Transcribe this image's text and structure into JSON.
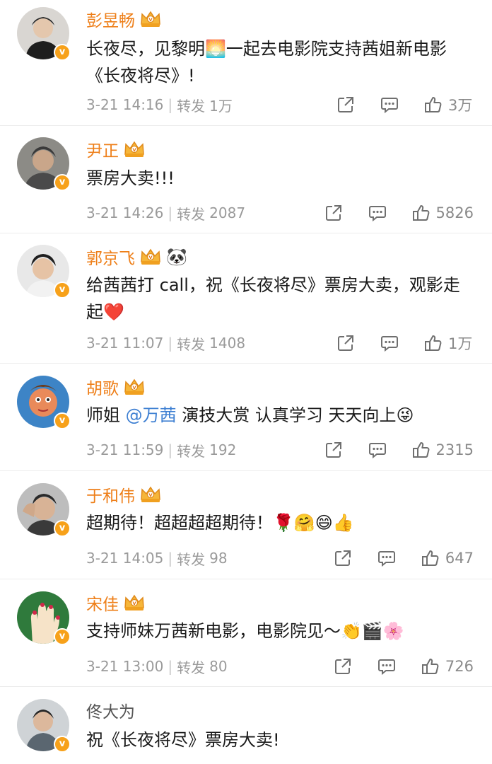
{
  "comments": [
    {
      "name": "彭昱畅",
      "text": "长夜尽，见黎明🌅一起去电影院支持茜姐新电影《长夜将尽》!",
      "time": "3-21 14:16",
      "repost_label": "转发",
      "repost_count": "1万",
      "likes": "3万"
    },
    {
      "name": "尹正",
      "text": "票房大卖!!!",
      "time": "3-21 14:26",
      "repost_label": "转发",
      "repost_count": "2087",
      "likes": "5826"
    },
    {
      "name": "郭京飞",
      "name_emoji": "🐼",
      "text": "给茜茜打 call，祝《长夜将尽》票房大卖，观影走起❤️",
      "time": "3-21 11:07",
      "repost_label": "转发",
      "repost_count": "1408",
      "likes": "1万"
    },
    {
      "name": "胡歌",
      "text_before": "师姐 ",
      "mention": "@万茜",
      "text_after": " 演技大赏 认真学习 天天向上😜",
      "time": "3-21 11:59",
      "repost_label": "转发",
      "repost_count": "192",
      "likes": "2315"
    },
    {
      "name": "于和伟",
      "text": "超期待！超超超超期待！🌹🤗😄👍",
      "time": "3-21 14:05",
      "repost_label": "转发",
      "repost_count": "98",
      "likes": "647"
    },
    {
      "name": "宋佳",
      "text": "支持师妹万茜新电影，电影院见～👏🎬🌸",
      "time": "3-21 13:00",
      "repost_label": "转发",
      "repost_count": "80",
      "likes": "726"
    },
    {
      "name": "佟大为",
      "text": "祝《长夜将尽》票房大卖!"
    }
  ],
  "verified_badge": "v",
  "colors": {
    "vip_name": "#ee7f19",
    "plain_name": "#555555",
    "mention": "#3d7fd2",
    "meta": "#9a9a9a",
    "badge": "#f7a11a"
  },
  "icons": [
    "crown-icon",
    "share-icon",
    "comment-icon",
    "like-icon",
    "verified-badge-icon"
  ]
}
